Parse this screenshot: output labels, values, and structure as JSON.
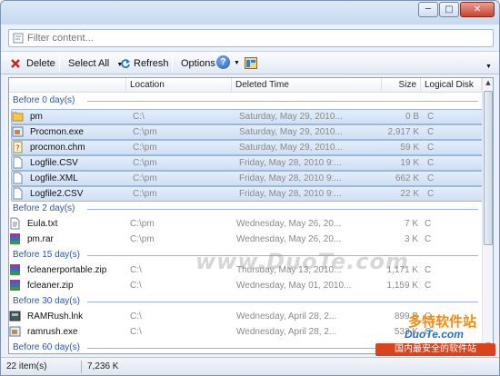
{
  "window": {
    "buttons": {
      "minimize": "─",
      "maximize": "□",
      "close": "✕"
    }
  },
  "filter": {
    "placeholder": "Filter content..."
  },
  "toolbar": {
    "delete": "Delete",
    "select_all": "Select All",
    "refresh": "Refresh",
    "options": "Options",
    "help": "?"
  },
  "columns": [
    "Location",
    "Deleted Time",
    "Size",
    "Logical Disk"
  ],
  "groups": [
    {
      "label": "Before 0 day(s)"
    },
    {
      "label": "Before 2 day(s)"
    },
    {
      "label": "Before 15 day(s)"
    },
    {
      "label": "Before 30 day(s)"
    },
    {
      "label": "Before 60 day(s)"
    }
  ],
  "rows": [
    {
      "icon": "folder-icon",
      "name": "pm",
      "location": "C:\\",
      "deleted": "Saturday, May 29, 2010...",
      "size": "0 B",
      "disk": "C",
      "selected": true
    },
    {
      "icon": "exe-icon",
      "name": "Procmon.exe",
      "location": "C:\\pm",
      "deleted": "Saturday, May 29, 2010...",
      "size": "2,917 K",
      "disk": "C",
      "selected": true
    },
    {
      "icon": "chm-icon",
      "name": "procmon.chm",
      "location": "C:\\pm",
      "deleted": "Saturday, May 29, 2010...",
      "size": "59 K",
      "disk": "C",
      "selected": true
    },
    {
      "icon": "file-icon",
      "name": "Logfile.CSV",
      "location": "C:\\pm",
      "deleted": "Friday, May 28, 2010 9:...",
      "size": "19 K",
      "disk": "C",
      "selected": true
    },
    {
      "icon": "file-icon",
      "name": "Logfile.XML",
      "location": "C:\\pm",
      "deleted": "Friday, May 28, 2010 9:...",
      "size": "662 K",
      "disk": "C",
      "selected": true
    },
    {
      "icon": "file-icon",
      "name": "Logfile2.CSV",
      "location": "C:\\pm",
      "deleted": "Friday, May 28, 2010 9:...",
      "size": "22 K",
      "disk": "C",
      "selected": true
    },
    {
      "icon": "txt-icon",
      "name": "Eula.txt",
      "location": "C:\\pm",
      "deleted": "Wednesday, May 26, 20...",
      "size": "7 K",
      "disk": "C",
      "selected": false
    },
    {
      "icon": "rar-icon",
      "name": "pm.rar",
      "location": "C:\\pm",
      "deleted": "Wednesday, May 26, 20...",
      "size": "3 K",
      "disk": "C",
      "selected": false
    },
    {
      "icon": "rar-icon",
      "name": "fcleanerportable.zip",
      "location": "C:\\",
      "deleted": "Thursday, May 13, 2010...",
      "size": "1,171 K",
      "disk": "C",
      "selected": false
    },
    {
      "icon": "rar-icon",
      "name": "fcleaner.zip",
      "location": "C:\\",
      "deleted": "Wednesday, May 01, 2010...",
      "size": "1,159 K",
      "disk": "C",
      "selected": false
    },
    {
      "icon": "lnk-icon",
      "name": "RAMRush.lnk",
      "location": "C:\\",
      "deleted": "Wednesday, April 28, 2...",
      "size": "899 B",
      "disk": "C",
      "selected": false
    },
    {
      "icon": "exe-icon",
      "name": "ramrush.exe",
      "location": "C:\\",
      "deleted": "Wednesday, April 28, 2...",
      "size": "533 K",
      "disk": "C",
      "selected": false
    }
  ],
  "status": {
    "items": "22 item(s)",
    "total": "7,236 K"
  },
  "watermark": "www.DuoTe.com",
  "brand": {
    "line1": "多特软件站",
    "line2": "DuoTe.com",
    "line3": "国内最安全的软件站"
  },
  "colors": {
    "group_text": "#2a56b4",
    "selection": "#cfdff4",
    "accent_orange": "#f18c12",
    "brand_red": "#d9431d"
  }
}
